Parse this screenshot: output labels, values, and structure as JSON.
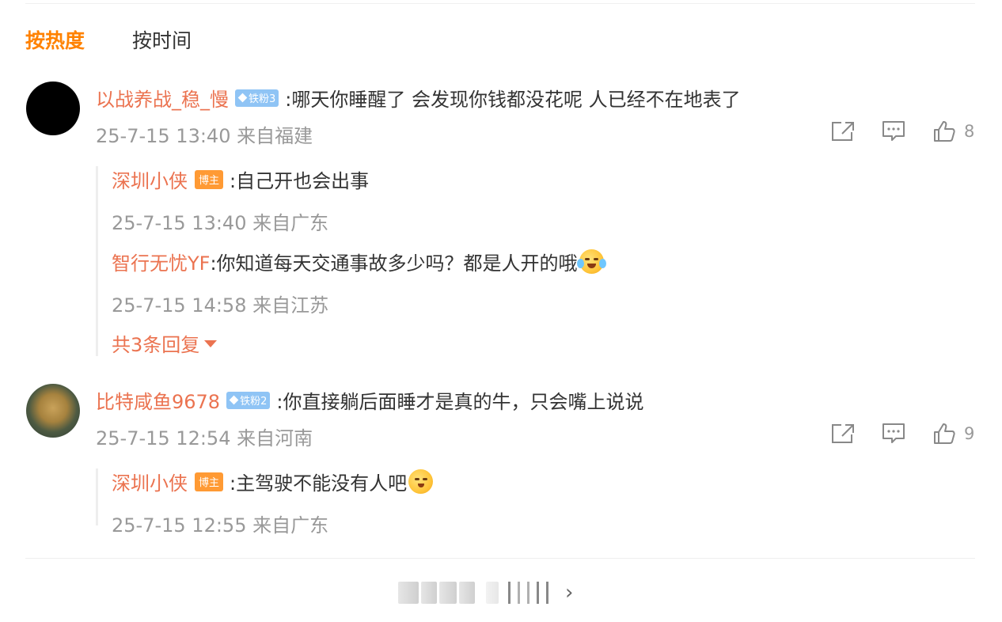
{
  "sort_tabs": {
    "hot": "按热度",
    "time": "按时间"
  },
  "comments": [
    {
      "user": "以战养战_稳_慢",
      "fan_badge": "铁粉3",
      "text": ":哪天你睡醒了 会发现你钱都没花呢 人已经不在地表了",
      "meta": "25-7-15 13:40 来自福建",
      "likes": "8",
      "replies": [
        {
          "user": "深圳小侠",
          "badge": "博主",
          "text": ":自己开也会出事",
          "meta": "25-7-15 13:40 来自广东"
        },
        {
          "user": "智行无忧YF",
          "text": ":你知道每天交通事故多少吗？都是人开的哦",
          "emoji": "crying-laughing-emoji",
          "meta": "25-7-15 14:58 来自江苏"
        }
      ],
      "more_replies": "共3条回复"
    },
    {
      "user": "比特咸鱼9678",
      "fan_badge": "铁粉2",
      "text": ":你直接躺后面睡才是真的牛，只会嘴上说说",
      "meta": "25-7-15 12:54 来自河南",
      "likes": "9",
      "replies": [
        {
          "user": "深圳小侠",
          "badge": "博主",
          "text": ":主驾驶不能没有人吧",
          "emoji": "shy-face-emoji",
          "meta": "25-7-15 12:55 来自广东"
        }
      ]
    }
  ],
  "colors": {
    "accent_orange": "#ff8200",
    "username": "#eb7350",
    "meta_gray": "#999999",
    "fan_badge": "#8fc4f5",
    "owner_badge": "#ff9a34"
  },
  "icons": [
    "share-icon",
    "comment-icon",
    "like-icon",
    "chevron-right-icon",
    "caret-down-icon"
  ]
}
